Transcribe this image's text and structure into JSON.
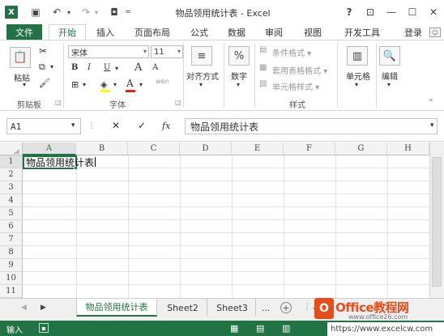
{
  "window": {
    "title": "物品领用统计表 - Excel",
    "app_icon": "X",
    "help": "?",
    "controls": {
      "restore_ribbon": "⊡",
      "minimize": "—",
      "maximize": "☐",
      "close": "✕"
    }
  },
  "qat": {
    "save": "💾",
    "undo": "↶",
    "redo": "↷",
    "camera": "📷",
    "more": "⌄"
  },
  "tabs": [
    {
      "label": "文件"
    },
    {
      "label": "开始"
    },
    {
      "label": "插入"
    },
    {
      "label": "页面布局"
    },
    {
      "label": "公式"
    },
    {
      "label": "数据"
    },
    {
      "label": "审阅"
    },
    {
      "label": "视图"
    },
    {
      "label": "开发工具"
    },
    {
      "label": "登录"
    }
  ],
  "ribbon": {
    "clipboard": {
      "paste": "粘贴",
      "label": "剪贴板"
    },
    "font": {
      "name": "宋体",
      "size": "11",
      "bold": "B",
      "italic": "I",
      "underline": "U",
      "grow": "A",
      "shrink": "A",
      "color": "A",
      "phonetic": "wén",
      "label": "字体"
    },
    "align": {
      "label": "对齐方式"
    },
    "number": {
      "label": "数字",
      "icon": "%"
    },
    "styles": {
      "cond": "条件格式 ▾",
      "table": "套用表格格式 ▾",
      "cell": "单元格样式 ▾",
      "label": "样式"
    },
    "cells": {
      "label": "单元格"
    },
    "edit": {
      "label": "编辑"
    }
  },
  "formula": {
    "namebox": "A1",
    "content": "物品领用统计表",
    "cancel": "✕",
    "enter": "✓",
    "fx": "fx"
  },
  "grid": {
    "columns": [
      "A",
      "B",
      "C",
      "D",
      "E",
      "F",
      "G",
      "H"
    ],
    "rows": [
      "1",
      "2",
      "3",
      "4",
      "5",
      "6",
      "7",
      "8",
      "9",
      "10",
      "11"
    ],
    "a1": "物品领用统计表"
  },
  "sheets": {
    "active": "物品领用统计表",
    "others": [
      "Sheet2",
      "Sheet3"
    ],
    "more": "...",
    "add": "+"
  },
  "status": {
    "mode": "输入"
  },
  "watermark": {
    "line1": "Office教程网",
    "line2": "www.office26.com",
    "url": "https://www.excelcw.com"
  }
}
